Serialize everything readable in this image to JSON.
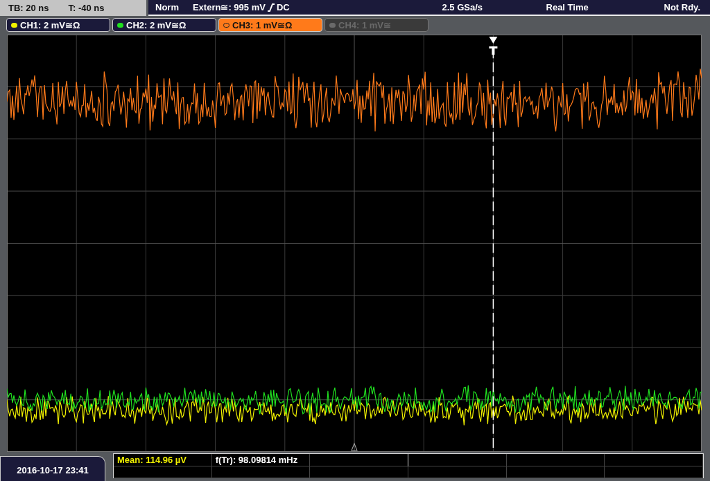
{
  "status_bar": {
    "timebase": "TB: 20 ns",
    "trigger_time": "T: -40 ns",
    "trigger_mode": "Norm",
    "trigger_source": "Extern≅: 995 mV",
    "trigger_coupling": "DC",
    "sample_rate": "2.5 GSa/s",
    "acquisition": "Real Time",
    "state": "Not Rdy."
  },
  "channels": [
    {
      "label": "CH1: 2 mV≅Ω",
      "color": "#f0f000",
      "selected": false,
      "enabled": true
    },
    {
      "label": "CH2: 2 mV≅Ω",
      "color": "#20e020",
      "selected": false,
      "enabled": true
    },
    {
      "label": "CH3: 1 mV≅Ω",
      "color": "#ff7a1a",
      "selected": true,
      "enabled": true
    },
    {
      "label": "CH4: 1 mV≅",
      "color": "#6a6a6a",
      "selected": false,
      "enabled": false
    }
  ],
  "datetime": "2016-10-17 23:41",
  "measurements": [
    {
      "text": "Mean: 114.96 µV",
      "kind": "channel"
    },
    {
      "text": "f(Tr): 98.09814 mHz",
      "kind": "trigger"
    }
  ]
}
